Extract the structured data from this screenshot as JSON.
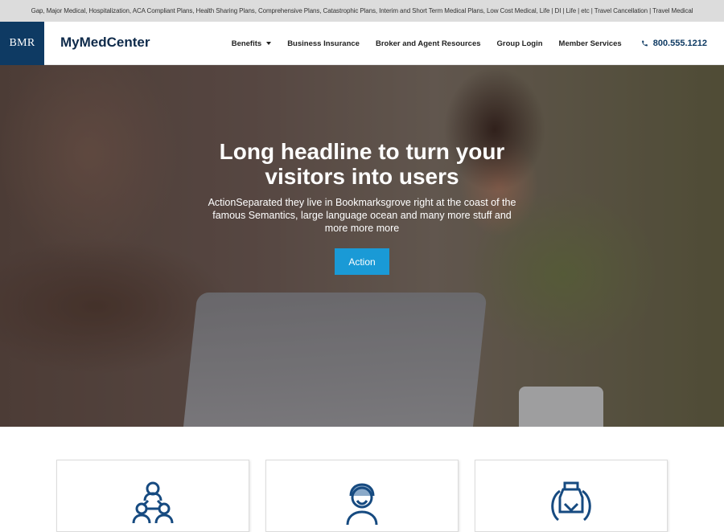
{
  "topbar": {
    "text": "Gap, Major Medical, Hospitalization, ACA Compliant Plans, Health Sharing Plans, Comprehensive Plans, Catastrophic Plans, Interim and Short Term Medical Plans, Low Cost Medical, Life | DI | Life | etc | Travel Cancellation | Travel Medical"
  },
  "header": {
    "logo_text": "BMR",
    "brand": "MyMedCenter",
    "nav": [
      {
        "label": "Benefits",
        "has_dropdown": true
      },
      {
        "label": "Business Insurance"
      },
      {
        "label": "Broker and Agent Resources"
      },
      {
        "label": "Group Login"
      },
      {
        "label": "Member Services"
      }
    ],
    "phone": "800.555.1212",
    "phone_icon": "phone-icon"
  },
  "hero": {
    "headline": "Long headline to turn your visitors into users",
    "subtext": "ActionSeparated they live in Bookmarksgrove right at the coast of the famous Semantics, large language ocean and many more stuff and more more more",
    "button_label": "Action"
  },
  "cards": [
    {
      "icon": "people-network-icon"
    },
    {
      "icon": "person-icon"
    },
    {
      "icon": "hands-icon"
    }
  ],
  "colors": {
    "brand_navy": "#0e3a63",
    "accent_blue": "#1a9ad6",
    "topbar_gray": "#dcdcdc",
    "icon_blue": "#164a80"
  }
}
